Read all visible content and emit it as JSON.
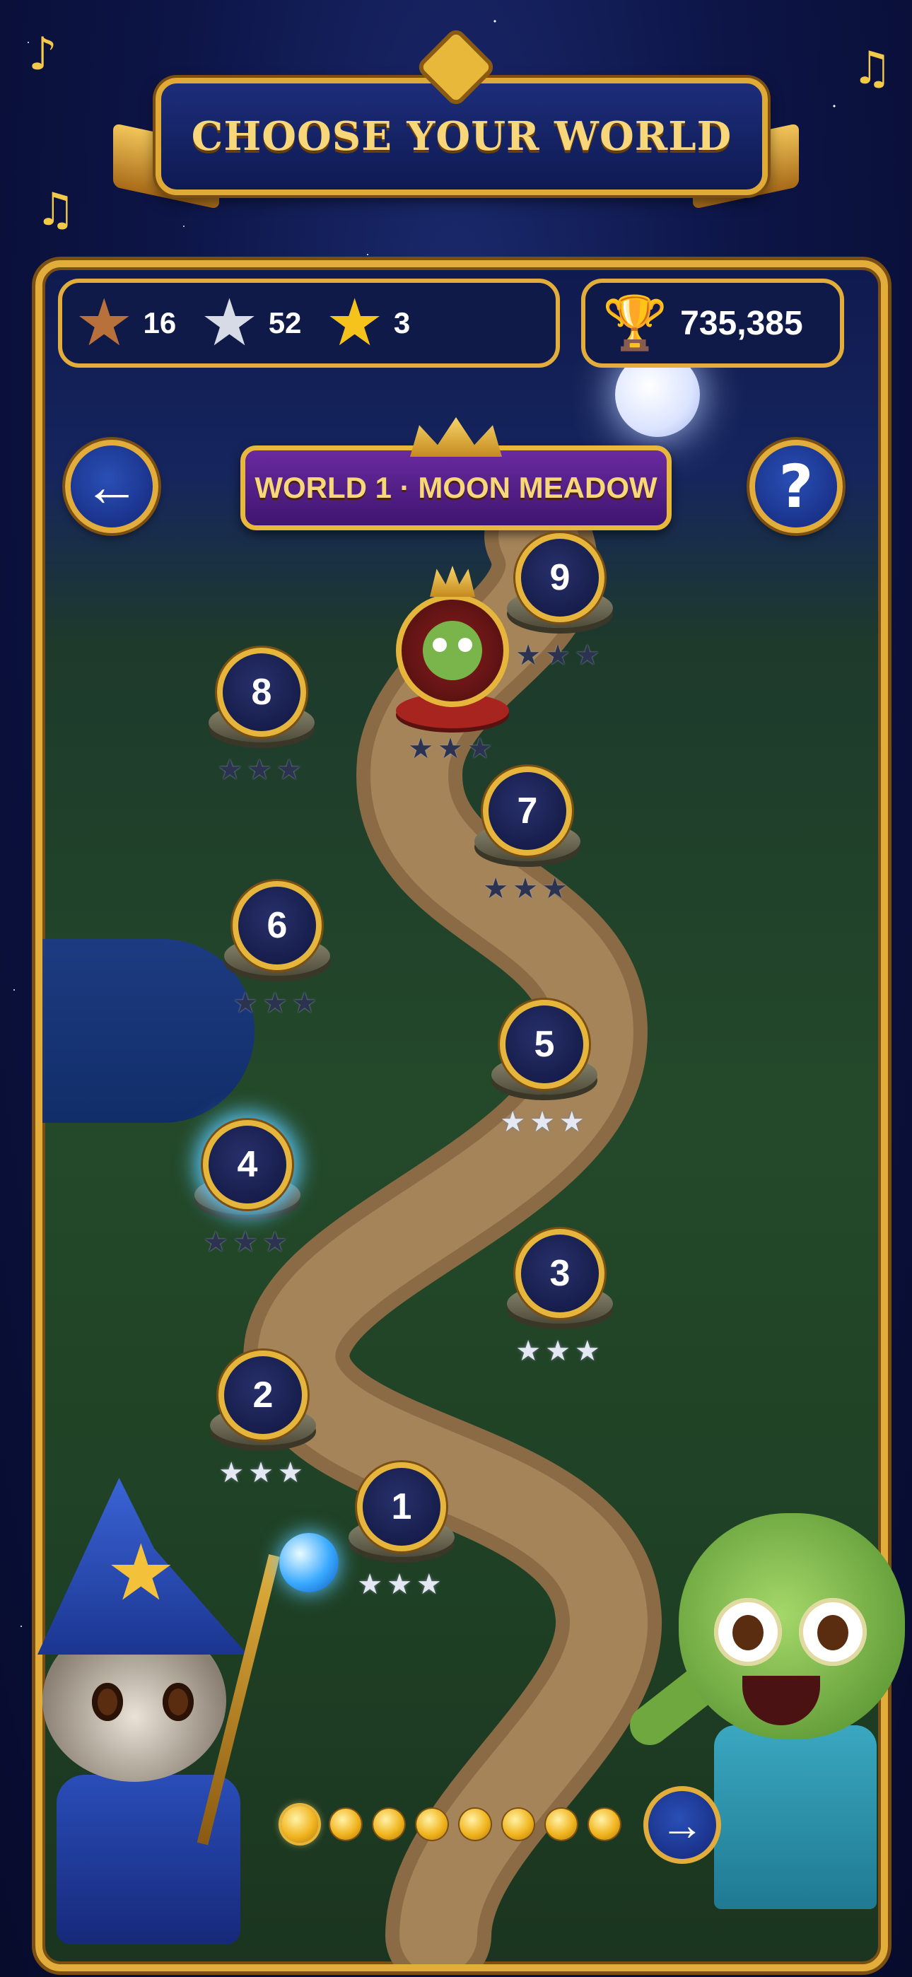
{
  "title": "CHOOSE YOUR WORLD",
  "world_title": "WORLD 1 · MOON MEADOW",
  "stats": {
    "bronze_stars": "16",
    "silver_stars": "52",
    "gold_stars": "3",
    "score": "735,385"
  },
  "icons": {
    "bronze_star": "bronze-star-icon",
    "silver_star": "silver-star-icon",
    "gold_star": "gold-star-icon",
    "trophy": "trophy-icon",
    "back": "arrow-left-icon",
    "help": "question-icon",
    "next": "arrow-right-icon"
  },
  "buttons": {
    "back_glyph": "←",
    "help_glyph": "?",
    "next_glyph": "→"
  },
  "levels": [
    {
      "number": "1",
      "stars": [
        "silver",
        "silver",
        "silver"
      ]
    },
    {
      "number": "2",
      "stars": [
        "silver",
        "silver",
        "silver"
      ]
    },
    {
      "number": "3",
      "stars": [
        "silver",
        "silver",
        "silver"
      ]
    },
    {
      "number": "4",
      "stars": [
        "empty",
        "empty",
        "empty"
      ],
      "current": true
    },
    {
      "number": "5",
      "stars": [
        "silver",
        "silver",
        "silver"
      ]
    },
    {
      "number": "6",
      "stars": [
        "empty",
        "empty",
        "empty"
      ]
    },
    {
      "number": "7",
      "stars": [
        "empty",
        "empty",
        "empty"
      ]
    },
    {
      "number": "8",
      "stars": [
        "empty",
        "empty",
        "empty"
      ]
    },
    {
      "number": "9",
      "stars": [
        "empty",
        "empty",
        "empty"
      ]
    }
  ],
  "boss": {
    "stars": [
      "empty",
      "empty",
      "empty"
    ]
  },
  "pager": {
    "pages": 8,
    "active_page": 1
  },
  "colors": {
    "frame_gold": "#e2ad3a",
    "panel_navy": "#101a48",
    "world_purple": "#5a2390",
    "current_glow": "#5cc8ff"
  }
}
